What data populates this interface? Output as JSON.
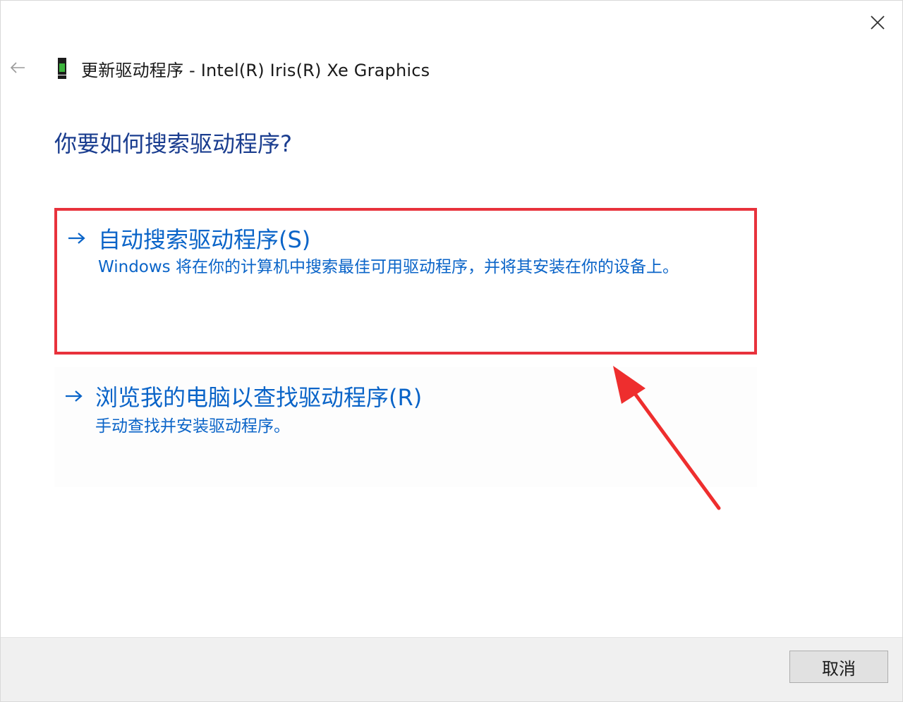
{
  "window": {
    "title": "更新驱动程序 - Intel(R) Iris(R) Xe Graphics",
    "close_icon": "close-icon",
    "back_icon": "back-arrow-icon",
    "device_icon": "display-adapter-icon"
  },
  "main": {
    "heading": "你要如何搜索驱动程序?",
    "options": [
      {
        "icon": "arrow-right-icon",
        "title": "自动搜索驱动程序(S)",
        "description": "Windows 将在你的计算机中搜索最佳可用驱动程序，并将其安装在你的设备上。"
      },
      {
        "icon": "arrow-right-icon",
        "title": "浏览我的电脑以查找驱动程序(R)",
        "description": "手动查找并安装驱动程序。"
      }
    ]
  },
  "footer": {
    "cancel_label": "取消"
  },
  "colors": {
    "link_blue": "#0a64c8",
    "heading_blue": "#1a3d8f",
    "highlight_red": "#e8323c"
  }
}
